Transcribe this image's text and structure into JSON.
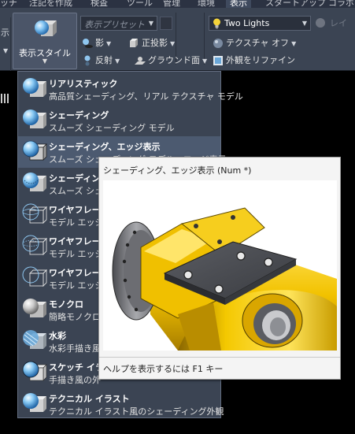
{
  "tabs": [
    {
      "label": "ッチ",
      "active": false
    },
    {
      "label": "注記を作成",
      "active": false
    },
    {
      "label": "検査",
      "active": false
    },
    {
      "label": "ツール",
      "active": false
    },
    {
      "label": "管理",
      "active": false
    },
    {
      "label": "環境",
      "active": false
    },
    {
      "label": "表示",
      "active": true
    },
    {
      "label": "スタートアップ",
      "active": false
    },
    {
      "label": "コラボレ",
      "active": false
    }
  ],
  "ribbon": {
    "left_edge_text": "示",
    "visual_style": {
      "label": "表示スタイル",
      "icon": "shaded-sphere-cube-icon"
    },
    "preset_combo": {
      "placeholder": "表示プリセット"
    },
    "lights_combo": {
      "value": "Two Lights",
      "icon": "light-bulb-icon"
    },
    "layer_toggle": {
      "label": "レイ"
    },
    "buttons": {
      "shadow": "影",
      "ortho": "正投影",
      "texture_off": "テクスチャ オフ",
      "reflection": "反射",
      "ground": "グラウンド面",
      "refine": "外観をリファイン"
    }
  },
  "menu": {
    "items": [
      {
        "name": "realistic",
        "title": "リアリスティック",
        "desc": "高品質シェーディング、リアル テクスチャ モデル",
        "icon": "realistic-style-icon",
        "highlighted": false
      },
      {
        "name": "shaded",
        "title": "シェーディング",
        "desc": "スムーズ シェーディング モデル",
        "icon": "shaded-style-icon",
        "highlighted": false
      },
      {
        "name": "shaded-edges",
        "title": "シェーディング、エッジ表示",
        "desc": "スムーズ シェーディング モデル、エッジ表示",
        "icon": "shaded-edges-style-icon",
        "highlighted": true
      },
      {
        "name": "shaded-hidden",
        "title": "シェーディング",
        "desc": "スムーズ シェ",
        "icon": "shaded-hidden-style-icon",
        "highlighted": false
      },
      {
        "name": "wireframe-1",
        "title": "ワイヤフレーム",
        "desc": "モデル エッジの",
        "icon": "wireframe-style-icon",
        "highlighted": false
      },
      {
        "name": "wireframe-2",
        "title": "ワイヤフレーム",
        "desc": "モデル エッジ、",
        "icon": "wireframe-hidden-style-icon",
        "highlighted": false
      },
      {
        "name": "wireframe-3",
        "title": "ワイヤフレーム",
        "desc": "モデル エッジ、",
        "icon": "wireframe-visible-style-icon",
        "highlighted": false
      },
      {
        "name": "monochrome",
        "title": "モノクロ",
        "desc": "簡略モノクロ",
        "icon": "monochrome-style-icon",
        "highlighted": false
      },
      {
        "name": "watercolor",
        "title": "水彩",
        "desc": "水彩手描き風",
        "icon": "watercolor-style-icon",
        "highlighted": false
      },
      {
        "name": "sketch",
        "title": "スケッチ イラスト",
        "desc": "手描き風の外",
        "icon": "sketch-style-icon",
        "highlighted": false
      },
      {
        "name": "technical",
        "title": "テクニカル イラスト",
        "desc": "テクニカル イラスト風のシェーディング外観",
        "icon": "technical-style-icon",
        "highlighted": false
      }
    ]
  },
  "tooltip": {
    "title": "シェーディング、エッジ表示 (Num *)",
    "help": "ヘルプを表示するには F1 キー",
    "image_icon": "yellow-part-preview-image"
  },
  "colors": {
    "ribbon_bg": "#3b4453",
    "menu_bg": "#3b4453",
    "menu_highlight": "#4c5a70",
    "tooltip_bg": "#f4f4f4",
    "part_yellow": "#f2c200",
    "viewport_bg": "#000000"
  }
}
